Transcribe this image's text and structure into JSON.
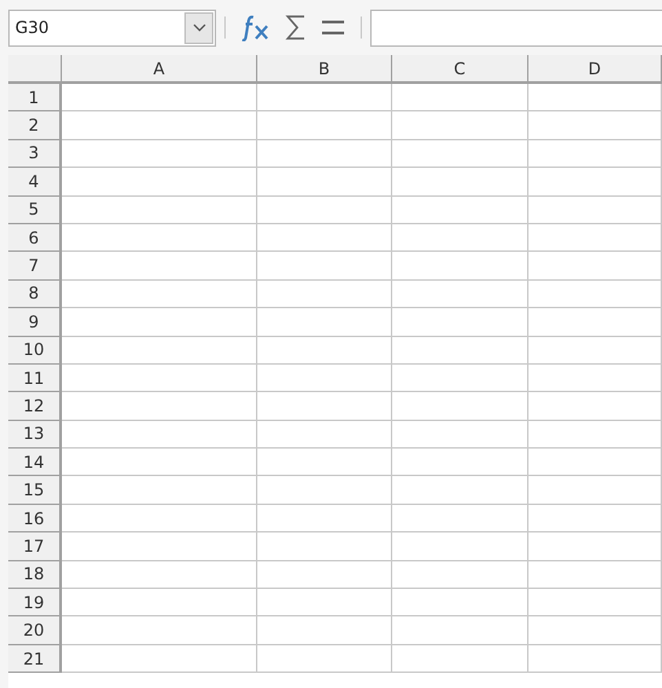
{
  "name_box": {
    "value": "G30"
  },
  "columns": [
    "A",
    "B",
    "C",
    "D"
  ],
  "rows": [
    "1",
    "2",
    "3",
    "4",
    "5",
    "6",
    "7",
    "8",
    "9",
    "10",
    "11",
    "12",
    "13",
    "14",
    "15",
    "16",
    "17",
    "18",
    "19",
    "20",
    "21"
  ]
}
